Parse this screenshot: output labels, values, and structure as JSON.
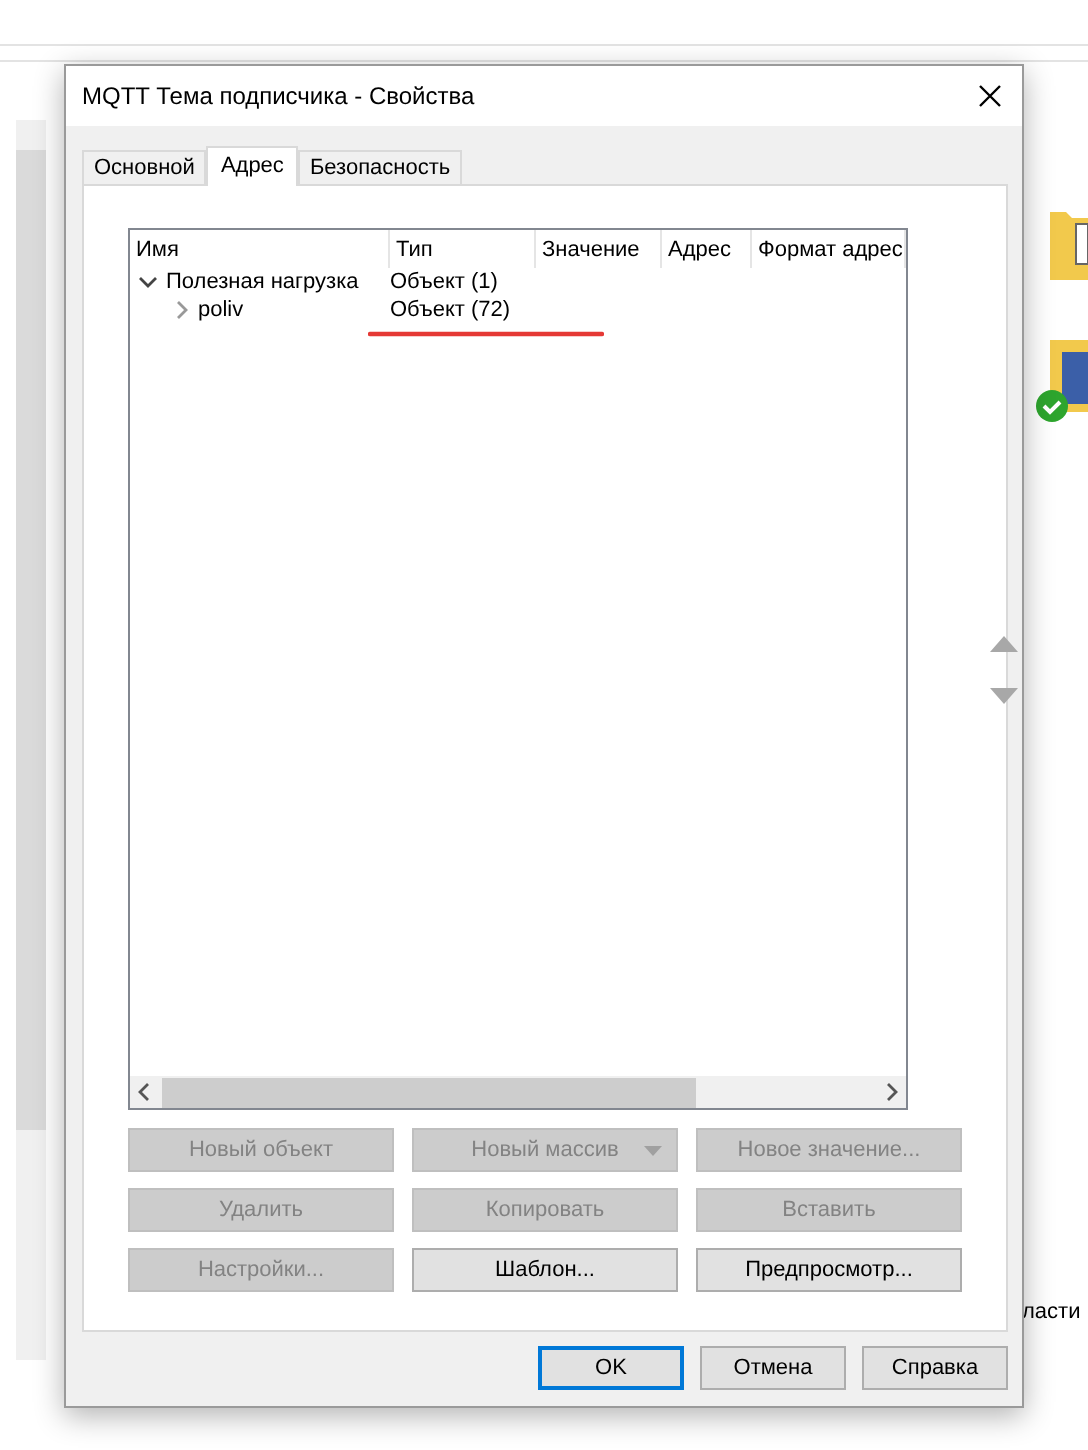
{
  "background": {
    "side_text": "ласти"
  },
  "dialog": {
    "title": "MQTT Тема подписчика - Свойства",
    "tabs": [
      {
        "label": "Основной",
        "selected": false
      },
      {
        "label": "Адрес",
        "selected": true
      },
      {
        "label": "Безопасность",
        "selected": false
      }
    ],
    "tree": {
      "columns": [
        "Имя",
        "Тип",
        "Значение",
        "Адрес",
        "Формат адрес"
      ],
      "rows": [
        {
          "name": "Полезная нагрузка",
          "type": "Объект (1)",
          "expanded": true,
          "children": [
            {
              "name": "poliv",
              "type": "Объект (72)",
              "expanded": false
            }
          ]
        }
      ]
    },
    "buttons": [
      {
        "label": "Новый объект",
        "disabled": true,
        "kind": "plain"
      },
      {
        "label": "Новый массив",
        "disabled": true,
        "kind": "dropdown"
      },
      {
        "label": "Новое значение...",
        "disabled": true,
        "kind": "plain"
      },
      {
        "label": "Удалить",
        "disabled": true,
        "kind": "plain"
      },
      {
        "label": "Копировать",
        "disabled": true,
        "kind": "plain"
      },
      {
        "label": "Вставить",
        "disabled": true,
        "kind": "plain"
      },
      {
        "label": "Настройки...",
        "disabled": true,
        "kind": "plain"
      },
      {
        "label": "Шаблон...",
        "disabled": false,
        "kind": "plain"
      },
      {
        "label": "Предпросмотр...",
        "disabled": false,
        "kind": "plain"
      }
    ],
    "footer": [
      {
        "label": "OK",
        "default": true
      },
      {
        "label": "Отмена",
        "default": false
      },
      {
        "label": "Справка",
        "default": false
      }
    ]
  }
}
